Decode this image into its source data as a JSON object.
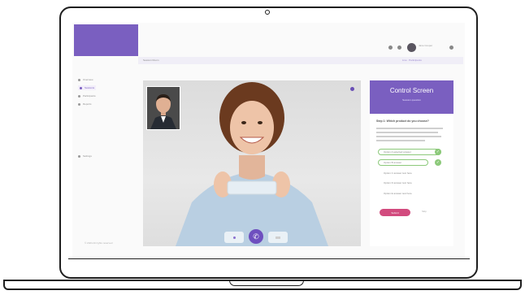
{
  "topbar": {
    "user_name": "Jane Cooper"
  },
  "subbar": {
    "title": "Session Room",
    "right_text": "Live  ·  Participants"
  },
  "sidebar": {
    "items": [
      {
        "label": "Overview"
      },
      {
        "label": "Sessions"
      },
      {
        "label": "Participants"
      },
      {
        "label": "Reports"
      },
      {
        "label": "Settings"
      }
    ],
    "footer": "© 2024 All rights reserved"
  },
  "panel": {
    "title": "Control Screen",
    "subtitle": "Session question",
    "question": "Step 1: Which product do you choose?",
    "options": [
      {
        "label": "Option A selected answer",
        "selected": true
      },
      {
        "label": "Option B answer",
        "selected": true
      },
      {
        "label": "Option C answer text here",
        "selected": false
      },
      {
        "label": "Option D answer text here",
        "selected": false
      },
      {
        "label": "Option E answer text here",
        "selected": false
      }
    ],
    "submit_label": "Submit",
    "skip_label": "Skip"
  },
  "colors": {
    "accent": "#7a5fc0",
    "success": "#8cc97a",
    "submit": "#d24b7e"
  },
  "icons": {
    "call": "phone-icon",
    "mute": "mic-icon",
    "video": "camera-icon"
  }
}
